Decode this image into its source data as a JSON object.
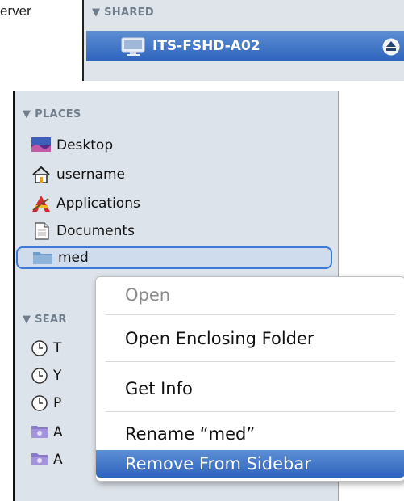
{
  "background_text": "erver",
  "shared": {
    "header": "▼ SHARED",
    "server": "ITS-FSHD-A02",
    "eject_icon": "eject-icon",
    "server_icon": "monitor-icon"
  },
  "places": {
    "header": "▼ PLACES",
    "items": [
      {
        "label": "Desktop",
        "icon": "desktop-icon"
      },
      {
        "label": "username",
        "icon": "home-icon"
      },
      {
        "label": "Applications",
        "icon": "applications-icon"
      },
      {
        "label": "Documents",
        "icon": "documents-icon"
      },
      {
        "label": "med",
        "icon": "folder-icon",
        "selected": true
      }
    ]
  },
  "search_for": {
    "header": "▼ SEAR",
    "items": [
      {
        "label": "T",
        "icon": "clock-icon"
      },
      {
        "label": "Y",
        "icon": "clock-icon"
      },
      {
        "label": "P",
        "icon": "clock-icon"
      },
      {
        "label": "A",
        "icon": "smart-folder-icon"
      },
      {
        "label": "A",
        "icon": "smart-folder-icon"
      }
    ]
  },
  "context_menu": {
    "items": [
      {
        "label": "Open",
        "enabled": false
      },
      {
        "label": "Open Enclosing Folder",
        "enabled": true
      },
      {
        "label": "Get Info",
        "enabled": true
      },
      {
        "label": "Rename “med”",
        "enabled": true
      },
      {
        "label": "Remove From Sidebar",
        "enabled": true,
        "highlighted": true
      }
    ]
  },
  "colors": {
    "selection_blue": "#2d63bd",
    "sidebar_bg": "#dde3ea",
    "header_text": "#6f7d8c"
  }
}
